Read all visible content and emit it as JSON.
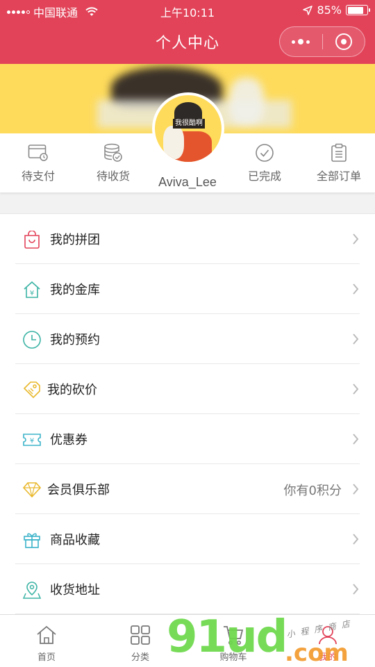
{
  "status_bar": {
    "carrier": "中国联通",
    "time": "上午10:11",
    "battery_percent": "85%",
    "battery_level": 0.85,
    "background": "#e24359"
  },
  "nav_bar": {
    "title": "个人中心",
    "background": "#e24359"
  },
  "profile": {
    "username": "Aviva_Lee",
    "avatar_sign_text": "我很酷啊",
    "banner_color": "#fedb5b"
  },
  "orders": [
    {
      "label": "待支付",
      "icon": "wallet-clock-icon"
    },
    {
      "label": "待收货",
      "icon": "coin-stack-icon"
    },
    {
      "label": "已完成",
      "icon": "check-circle-icon"
    },
    {
      "label": "全部订单",
      "icon": "clipboard-icon"
    }
  ],
  "menu": [
    {
      "label": "我的拼团",
      "icon": "shopping-bag-icon",
      "color": "#e24359",
      "extra": ""
    },
    {
      "label": "我的金库",
      "icon": "house-yen-icon",
      "color": "#3bb3a4",
      "extra": ""
    },
    {
      "label": "我的预约",
      "icon": "clock-icon",
      "color": "#3bb3a4",
      "extra": ""
    },
    {
      "label": "我的砍价",
      "icon": "price-tag-icon",
      "color": "#e9b82c",
      "extra": ""
    },
    {
      "label": "优惠券",
      "icon": "coupon-icon",
      "color": "#3bb3c9",
      "extra": ""
    },
    {
      "label": "会员俱乐部",
      "icon": "diamond-icon",
      "color": "#e9b82c",
      "extra": "你有0积分"
    },
    {
      "label": "商品收藏",
      "icon": "gift-icon",
      "color": "#3bb3c9",
      "extra": ""
    },
    {
      "label": "收货地址",
      "icon": "map-pin-icon",
      "color": "#3bb3a4",
      "extra": ""
    }
  ],
  "tab_bar": [
    {
      "label": "首页",
      "icon": "home-icon",
      "active": false
    },
    {
      "label": "分类",
      "icon": "grid-icon",
      "active": false
    },
    {
      "label": "购物车",
      "icon": "cart-icon",
      "active": false
    },
    {
      "label": "我的",
      "icon": "user-icon",
      "active": true
    }
  ],
  "watermark": {
    "main": "91ud",
    "domain": ".com",
    "handwriting": "小程序商店"
  }
}
